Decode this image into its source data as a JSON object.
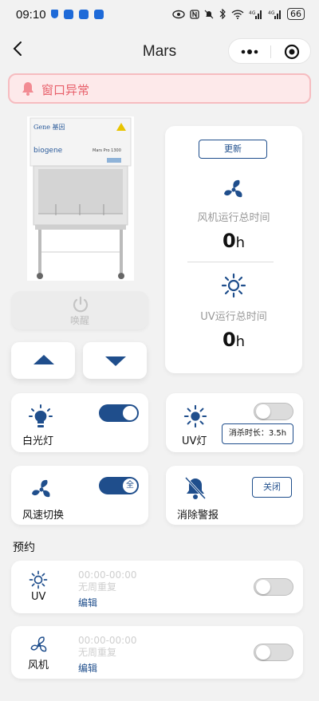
{
  "status_bar": {
    "time": "09:10",
    "battery": "66"
  },
  "nav": {
    "title": "Mars"
  },
  "alert": {
    "text": "窗口异常",
    "color": "#e85f6a"
  },
  "device": {
    "brand": "Gene 基因",
    "model": "Mars Pro 1300",
    "logo_text": "biogene"
  },
  "stats": {
    "refresh_label": "更新",
    "fan_label": "风机运行总时间",
    "fan_value": "0",
    "fan_unit": "h",
    "uv_label": "UV运行总时间",
    "uv_value": "0",
    "uv_unit": "h"
  },
  "wake": {
    "label": "唤醒"
  },
  "controls": {
    "white_light": {
      "label": "白光灯",
      "on": true
    },
    "uv_light": {
      "label": "UV灯",
      "on": false,
      "sterilize": "消杀时长：3.5h"
    },
    "fan_speed": {
      "label": "风速切换",
      "on": true,
      "toggle_text": "全"
    },
    "clear_alarm": {
      "label": "消除警报",
      "button": "关闭"
    }
  },
  "schedule": {
    "title": "预约",
    "items": [
      {
        "name": "UV",
        "time": "00:00-00:00",
        "repeat": "无周重复",
        "edit": "编辑",
        "on": false
      },
      {
        "name": "风机",
        "time": "00:00-00:00",
        "repeat": "无周重复",
        "edit": "编辑",
        "on": false
      }
    ]
  },
  "colors": {
    "accent": "#1f4e8c",
    "alert_bg": "#fde9ea",
    "background": "#f2f2f2"
  },
  "icons": [
    "back-arrow-icon",
    "more-icon",
    "target-icon",
    "bell-icon",
    "fan-icon",
    "sun-icon",
    "power-icon",
    "bulb-icon",
    "alarm-off-icon"
  ]
}
